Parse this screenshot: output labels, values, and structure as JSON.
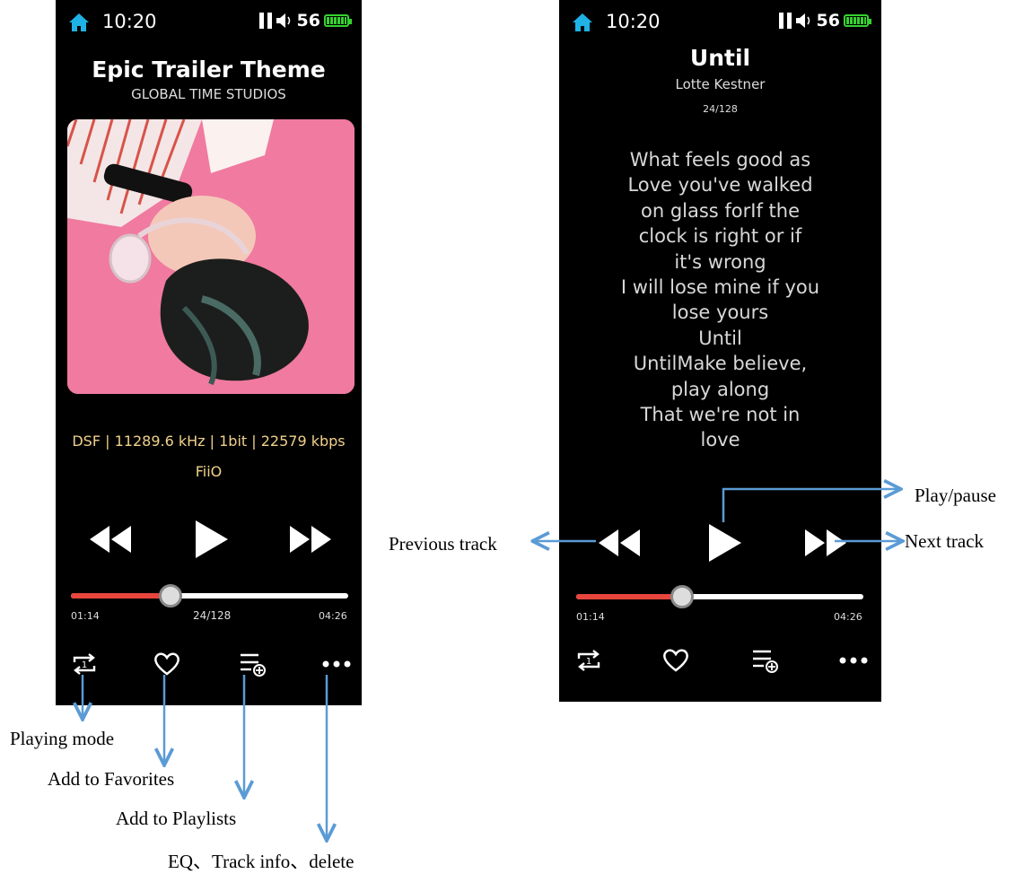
{
  "left_screen": {
    "status": {
      "time": "10:20",
      "volume": "56",
      "icons": [
        "home-icon",
        "pause-icon",
        "speaker-icon",
        "battery-icon"
      ]
    },
    "song_title": "Epic Trailer Theme",
    "artist": "GLOBAL TIME STUDIOS",
    "format_info": "DSF | 11289.6 kHz | 1bit | 22579 kbps",
    "brand": "FiiO",
    "elapsed": "01:14",
    "track_counter": "24/128",
    "duration": "04:26",
    "progress_fraction": 0.36
  },
  "right_screen": {
    "status": {
      "time": "10:20",
      "volume": "56"
    },
    "song_title": "Until",
    "artist": "Lotte Kestner",
    "track_counter": "24/128",
    "lyrics": [
      "What feels good as",
      "Love you've walked",
      "on glass forIf the",
      "clock is right or if",
      "it's wrong",
      "I will lose mine if you",
      "lose yours",
      "Until",
      "UntilMake believe,",
      "play along",
      "That we're not in",
      "love"
    ],
    "elapsed": "01:14",
    "duration": "04:26",
    "progress_fraction": 0.37
  },
  "annotations": {
    "playing_mode": "Playing mode",
    "add_favorites": "Add to Favorites",
    "add_playlists": "Add to Playlists",
    "more": "EQ、Track info、delete",
    "play_pause": "Play/pause",
    "previous": "Previous track",
    "next": "Next track"
  },
  "colors": {
    "home_icon": "#1fb2e6",
    "battery": "#36d22f",
    "format_text": "#f0d18b",
    "progress_fill": "#e8453c",
    "arrow": "#5b9bd5"
  }
}
